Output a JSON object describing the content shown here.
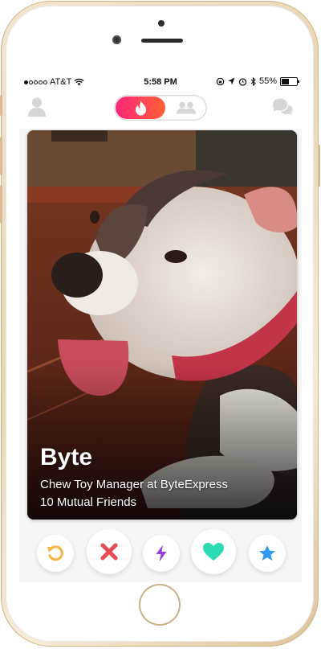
{
  "status_bar": {
    "carrier": "AT&T",
    "time": "5:58 PM",
    "battery": "55%",
    "battery_level": 0.55
  },
  "header": {
    "left_icon": "profile-icon",
    "right_icon": "chat-bubbles-icon",
    "toggle": {
      "active": "flame-icon",
      "inactive": "group-icon"
    }
  },
  "card": {
    "name": "Byte",
    "job": "Chew Toy Manager at ByteExpress",
    "mutual": "10 Mutual Friends"
  },
  "actions": [
    {
      "icon": "rewind-icon",
      "color": "#f5b748"
    },
    {
      "icon": "nope-x-icon",
      "color": "#e64c55"
    },
    {
      "icon": "boost-bolt-icon",
      "color": "#9b3ddb"
    },
    {
      "icon": "like-heart-icon",
      "color": "#2ddbb3"
    },
    {
      "icon": "super-like-star-icon",
      "color": "#2f9bf0"
    }
  ],
  "colors": {
    "brand_gradient_start": "#fd267a",
    "brand_gradient_end": "#ff6036",
    "header_icon_gray": "#d6d6d6"
  }
}
